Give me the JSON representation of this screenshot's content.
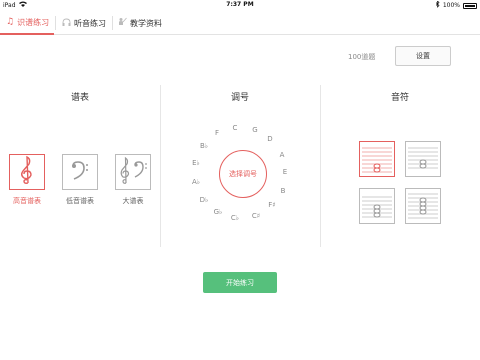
{
  "status_bar": {
    "device": "iPad",
    "time": "7:37 PM",
    "battery": "100%"
  },
  "tabs": [
    {
      "label": "识谱练习",
      "icon": "music-note-icon",
      "active": true
    },
    {
      "label": "听音练习",
      "icon": "headphones-icon",
      "active": false
    },
    {
      "label": "教学资料",
      "icon": "teacher-icon",
      "active": false
    }
  ],
  "question_count": "100道题",
  "settings_label": "设置",
  "sections": {
    "staff": {
      "title": "谱表",
      "options": [
        "高音谱表",
        "低音谱表",
        "大谱表"
      ],
      "selected": "高音谱表"
    },
    "key": {
      "title": "调号",
      "center_label": "选择调号",
      "keys": [
        "C",
        "G",
        "D",
        "A",
        "E",
        "B",
        "F♯",
        "C♯",
        "C♭",
        "G♭",
        "D♭",
        "A♭",
        "E♭",
        "B♭",
        "F"
      ]
    },
    "notes": {
      "title": "音符"
    }
  },
  "start_label": "开始练习",
  "colors": {
    "accent": "#e4605e",
    "start_button": "#56c07c"
  }
}
